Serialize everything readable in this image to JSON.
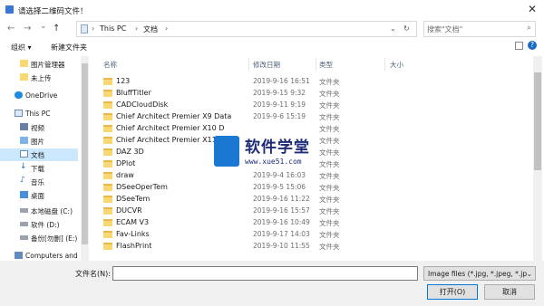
{
  "window": {
    "title": "请选择二维码文件！",
    "close": "✕"
  },
  "nav": {
    "back": "←",
    "forward": "→",
    "dropdown": "⌄",
    "up": "↑"
  },
  "address": {
    "path": [
      "This PC",
      "文档"
    ]
  },
  "search": {
    "placeholder": "搜索\"文档\""
  },
  "toolbar": {
    "organize": "组织 ▾",
    "new_folder": "新建文件夹"
  },
  "sidebar": {
    "items": [
      {
        "label": "图片管理器",
        "icon": "folder-icon"
      },
      {
        "label": "未上传",
        "icon": "folder-icon"
      },
      {
        "label": "OneDrive",
        "icon": "cloud-icon"
      },
      {
        "label": "This PC",
        "icon": "pc-icon"
      },
      {
        "label": "视频",
        "icon": "video-icon"
      },
      {
        "label": "图片",
        "icon": "picture-icon"
      },
      {
        "label": "文档",
        "icon": "document-icon",
        "selected": true
      },
      {
        "label": "下载",
        "icon": "download-icon"
      },
      {
        "label": "音乐",
        "icon": "music-icon"
      },
      {
        "label": "桌面",
        "icon": "desktop-icon"
      },
      {
        "label": "本地磁盘 (C:)",
        "icon": "drive-icon"
      },
      {
        "label": "软件 (D:)",
        "icon": "drive-icon"
      },
      {
        "label": "备份[勿删] (E:)",
        "icon": "drive-icon"
      },
      {
        "label": "Computers and",
        "icon": "network-icon"
      }
    ]
  },
  "list": {
    "columns": {
      "name": "名称",
      "date": "修改日期",
      "type": "类型",
      "size": "大小"
    },
    "rows": [
      {
        "name": "123",
        "date": "2019-9-16 16:51",
        "type": "文件夹"
      },
      {
        "name": "BluffTitler",
        "date": "2019-9-15 9:32",
        "type": "文件夹"
      },
      {
        "name": "CADCloudDisk",
        "date": "2019-9-11 9:19",
        "type": "文件夹"
      },
      {
        "name": "Chief Architect Premier X9 Data",
        "date": "2019-9-6 15:19",
        "type": "文件夹"
      },
      {
        "name": "Chief Architect Premier X10 D",
        "date": "",
        "type": "文件夹"
      },
      {
        "name": "Chief Architect Premier X11 D",
        "date": "",
        "type": "文件夹"
      },
      {
        "name": "DAZ 3D",
        "date": "",
        "type": "文件夹"
      },
      {
        "name": "DPlot",
        "date": "",
        "type": "文件夹"
      },
      {
        "name": "draw",
        "date": "2019-9-4 16:03",
        "type": "文件夹"
      },
      {
        "name": "DSeeOperTem",
        "date": "2019-9-5 15:06",
        "type": "文件夹"
      },
      {
        "name": "DSeeTem",
        "date": "2019-9-16 11:22",
        "type": "文件夹"
      },
      {
        "name": "DUCVR",
        "date": "2019-9-16 15:57",
        "type": "文件夹"
      },
      {
        "name": "ECAM V3",
        "date": "2019-9-16 10:49",
        "type": "文件夹"
      },
      {
        "name": "Fav-Links",
        "date": "2019-9-17 14:03",
        "type": "文件夹"
      },
      {
        "name": "FlashPrint",
        "date": "2019-9-10 11:55",
        "type": "文件夹"
      }
    ]
  },
  "bottom": {
    "filename_label": "文件名(N):",
    "filename_value": "",
    "filter": "Image files (*.jpg, *.jpeg, *.jp",
    "open": "打开(O)",
    "cancel": "取消"
  },
  "watermark": {
    "title": "软件学堂",
    "url": "www.xue51.com"
  }
}
